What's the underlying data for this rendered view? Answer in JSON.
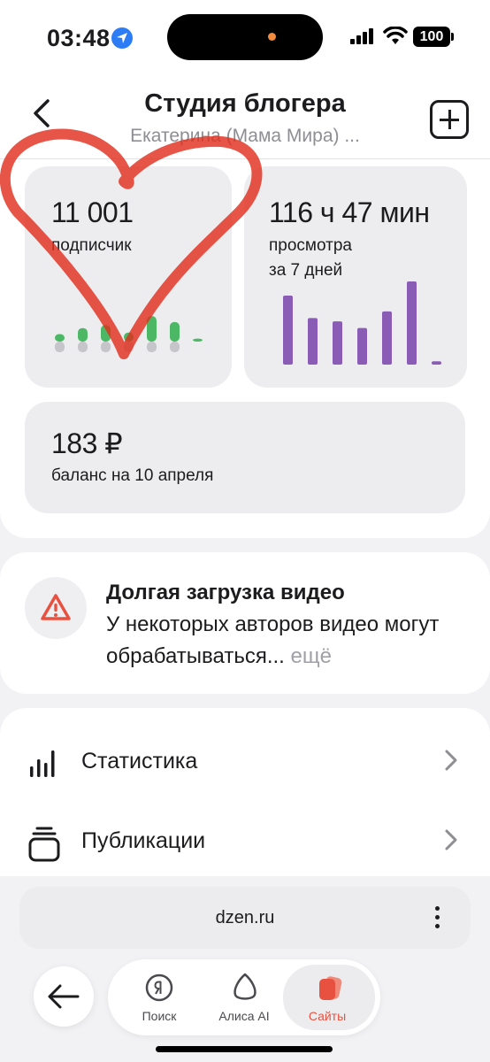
{
  "status_bar": {
    "time": "03:48",
    "battery": "100"
  },
  "header": {
    "title": "Студия блогера",
    "subtitle": "Екатерина (Мама Мира) ..."
  },
  "stats": {
    "subscribers": {
      "value": "11 001",
      "label": "подписчик",
      "bars": [
        0.25,
        0.45,
        0.55,
        0.3,
        0.85,
        0.65,
        0.1
      ]
    },
    "views": {
      "value": "116 ч 47 мин",
      "label_line1": "просмотра",
      "label_line2": "за 7 дней",
      "bars": [
        0.83,
        0.56,
        0.52,
        0.44,
        0.64,
        1.0,
        0.04
      ]
    },
    "balance": {
      "value": "183 ₽",
      "label": "баланс на 10 апреля"
    }
  },
  "notice": {
    "title": "Долгая загрузка видео",
    "text": "У некоторых авторов видео могут обрабатываться... ",
    "more": "ещё"
  },
  "menu": {
    "items": [
      {
        "label": "Статистика"
      },
      {
        "label": "Публикации"
      }
    ]
  },
  "browser": {
    "url": "dzen.ru"
  },
  "bottom_nav": {
    "items": [
      {
        "label": "Поиск",
        "icon": "yandex-icon"
      },
      {
        "label": "Алиса AI",
        "icon": "alice-icon"
      },
      {
        "label": "Сайты",
        "icon": "sites-icon"
      }
    ]
  },
  "colors": {
    "accent": "#e8513f",
    "subscriber_bars": "#4cb865",
    "views_bars": "#8a5cb5",
    "annotation": "#e0301e"
  }
}
